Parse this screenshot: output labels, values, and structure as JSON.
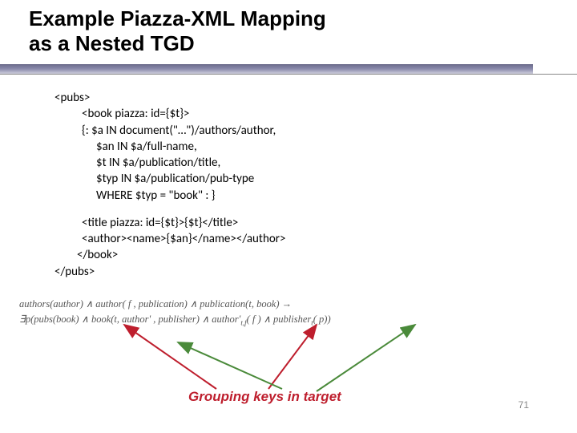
{
  "title_line1": "Example Piazza-XML Mapping",
  "title_line2": "as a Nested TGD",
  "code": {
    "l1": "<pubs>",
    "l2": "<book piazza: id={$t}>",
    "l3": "{:  $a IN document(\"…\")/authors/author,",
    "l4": "$an IN $a/full-name,",
    "l5": "$t IN $a/publication/title,",
    "l6": "$typ IN $a/publication/pub-type",
    "l7": "WHERE $typ = \"book\" : }",
    "l8": "<title piazza: id={$t}>{$t}</title>",
    "l9": "<author><name>{$an}</name></author>",
    "l10": "</book>",
    "l11": "</pubs>"
  },
  "formula": {
    "line1": "authors(author) ∧ author( f , publication) ∧ publication(t, book) →",
    "line2_prefix": "∃p(pubs(book) ∧ book(t, author' , publisher) ∧ author'",
    "line2_sub": "t,f",
    "line2_mid": "( f ) ∧ publisher",
    "line2_sub2": "t",
    "line2_suffix": "( p))"
  },
  "grouping_label": "Grouping keys in target",
  "page_number": "71"
}
